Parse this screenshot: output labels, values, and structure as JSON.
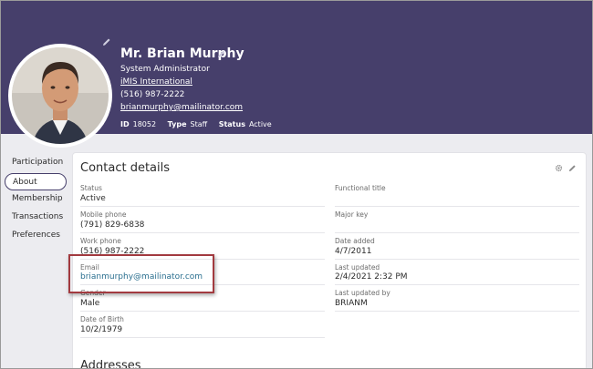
{
  "profile": {
    "name": "Mr. Brian Murphy",
    "title": "System Administrator",
    "organization": "iMIS International",
    "phone": "(516) 987-2222",
    "email": "brianmurphy@mailinator.com",
    "id_label": "ID",
    "id_value": "18052",
    "type_label": "Type",
    "type_value": "Staff",
    "status_label": "Status",
    "status_value": "Active"
  },
  "nav": {
    "items": [
      {
        "label": "Participation"
      },
      {
        "label": "About"
      },
      {
        "label": "Membership"
      },
      {
        "label": "Transactions"
      },
      {
        "label": "Preferences"
      }
    ],
    "active": "About"
  },
  "contact": {
    "title": "Contact details",
    "left_fields": [
      {
        "label": "Status",
        "value": "Active"
      },
      {
        "label": "Mobile phone",
        "value": "(791) 829-6838"
      },
      {
        "label": "Work phone",
        "value": "(516) 987-2222"
      },
      {
        "label": "Email",
        "value": "brianmurphy@mailinator.com"
      },
      {
        "label": "Gender",
        "value": "Male"
      },
      {
        "label": "Date of Birth",
        "value": "10/2/1979"
      }
    ],
    "right_fields": [
      {
        "label": "Functional title",
        "value": ""
      },
      {
        "label": "Major key",
        "value": ""
      },
      {
        "label": "Date added",
        "value": "4/7/2011"
      },
      {
        "label": "Last updated",
        "value": "2/4/2021 2:32 PM"
      },
      {
        "label": "Last updated by",
        "value": "BRIANM"
      }
    ]
  },
  "addresses": {
    "title": "Addresses"
  },
  "colors": {
    "header_bg": "#463f6b",
    "link": "#2a6f8f",
    "highlight": "#a23a3f"
  },
  "icons": [
    "pencil-icon",
    "gear-icon",
    "avatar-photo"
  ]
}
